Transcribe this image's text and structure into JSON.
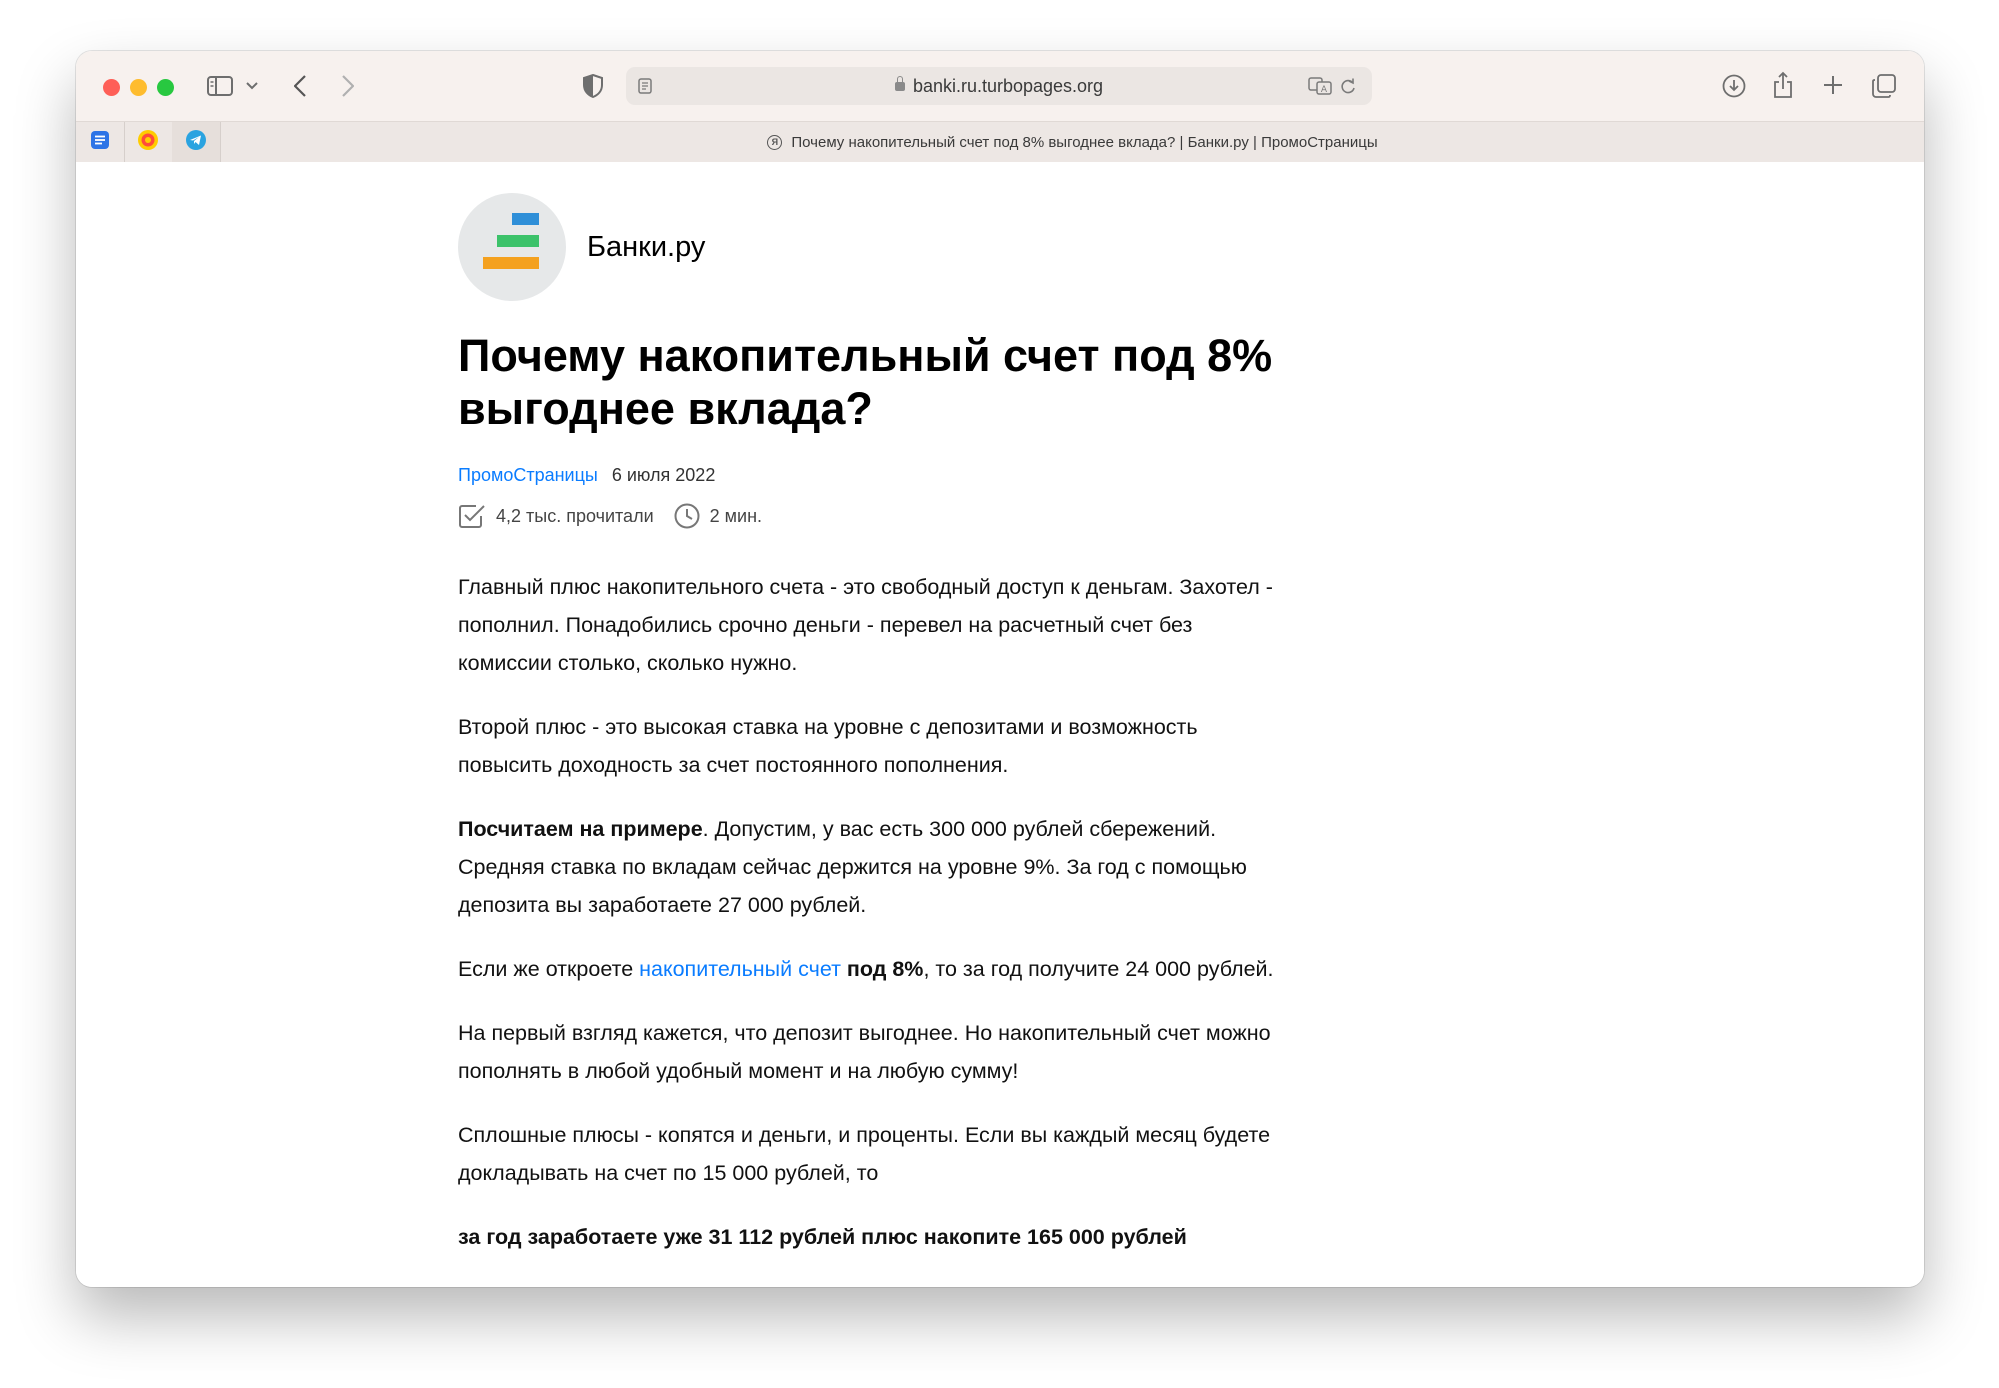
{
  "browser": {
    "url": "banki.ru.turbopages.org",
    "tab_title": "Почему накопительный счет под 8% выгоднее вклада? | Банки.ру | ПромоСтраницы",
    "tab_favicon": "Я",
    "pinned_tabs": [
      "docs-icon",
      "yandex-music-icon",
      "telegram-icon"
    ]
  },
  "article": {
    "publisher": "Банки.ру",
    "title": "Почему накопительный счет под 8% выгоднее вклада?",
    "category": "ПромоСтраницы",
    "date": "6 июля 2022",
    "reads": "4,2 тыс. прочитали",
    "read_time": "2 мин.",
    "p1": "Главный плюс накопительного счета - это свободный доступ к деньгам. Захотел - пополнил. Понадобились срочно деньги - перевел на расчетный счет без комиссии столько, сколько нужно.",
    "p2": "Второй плюс - это высокая ставка на уровне с депозитами и возможность повысить доходность за счет постоянного пополнения.",
    "p3_bold": "Посчитаем на примере",
    "p3_rest": ". Допустим, у вас есть 300 000 рублей сбережений. Средняя ставка по вкладам сейчас держится на уровне 9%. За год с помощью депозита вы заработаете 27 000 рублей.",
    "p4_a": "Если же откроете ",
    "p4_link": "накопительный счет",
    "p4_bold": " под 8%",
    "p4_rest": ", то за год получите 24 000 рублей.",
    "p5": "На первый взгляд кажется, что депозит выгоднее. Но накопительный счет можно пополнять в любой удобный момент и на любую сумму!",
    "p6": "Сплошные плюсы - копятся и деньги, и проценты. Если вы каждый месяц будете докладывать на счет по 15 000 рублей, то",
    "p7_bold": "за год заработаете уже 31 112 рублей плюс накопите 165 000 рублей"
  },
  "colors": {
    "link": "#0a7cff",
    "logo_blue": "#2f8fd8",
    "logo_green": "#3cc26a",
    "logo_orange": "#f4a11f"
  }
}
